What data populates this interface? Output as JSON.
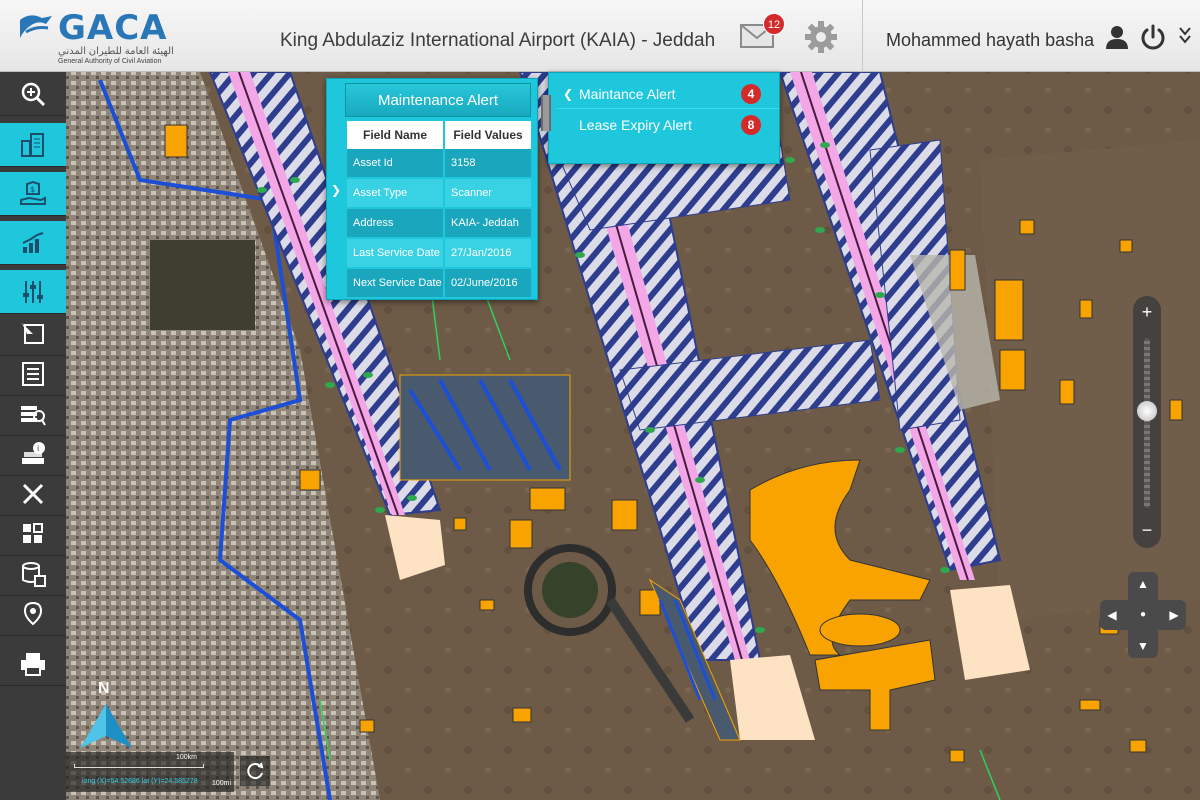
{
  "header": {
    "logo_text": "GACA",
    "logo_arabic": "الهيئة العامة للطيران المدني",
    "logo_english": "General Authority of Civil Aviation",
    "airport_title": "King Abdulaziz International Airport (KAIA) - Jeddah",
    "notification_count": "12",
    "user_name": "Mohammed  hayath basha",
    "icons": [
      "mail-icon",
      "gear-icon",
      "user-icon",
      "power-icon",
      "chevron-down-double-icon"
    ]
  },
  "sidebar": {
    "items": [
      {
        "name": "zoom-search",
        "icon": "magnifier-plus-icon",
        "active": false
      },
      {
        "name": "buildings",
        "icon": "buildings-icon",
        "active": true
      },
      {
        "name": "assets-finance",
        "icon": "money-hand-icon",
        "active": true
      },
      {
        "name": "analytics",
        "icon": "bar-chart-icon",
        "active": true
      },
      {
        "name": "settings-sliders",
        "icon": "sliders-icon",
        "active": true
      },
      {
        "name": "select-tool",
        "icon": "select-arrow-icon",
        "active": false
      },
      {
        "name": "report-list",
        "icon": "list-icon",
        "active": false
      },
      {
        "name": "layer-search",
        "icon": "layers-search-icon",
        "active": false
      },
      {
        "name": "asset-info",
        "icon": "stack-info-icon",
        "active": false
      },
      {
        "name": "measure-tool",
        "icon": "pencil-cross-icon",
        "active": false
      },
      {
        "name": "grid-view",
        "icon": "grid-icon",
        "active": false
      },
      {
        "name": "database-report",
        "icon": "database-icon",
        "active": false
      },
      {
        "name": "location-pin",
        "icon": "map-pin-icon",
        "active": false
      },
      {
        "name": "print",
        "icon": "printer-icon",
        "active": false
      }
    ]
  },
  "maintenance_popup": {
    "title": "Maintenance Alert",
    "col_field": "Field Name",
    "col_value": "Field Values",
    "rows": [
      {
        "field": "Asset Id",
        "value": "3158"
      },
      {
        "field": "Asset Type",
        "value": "Scanner"
      },
      {
        "field": "Address",
        "value": "KAIA- Jeddah"
      },
      {
        "field": "Last Service Date",
        "value": "27/Jan/2016"
      },
      {
        "field": "Next Service Date",
        "value": "02/June/2016"
      }
    ]
  },
  "alert_list": {
    "items": [
      {
        "label": "Maintance Alert",
        "count": "4"
      },
      {
        "label": "Lease Expiry Alert",
        "count": "8"
      }
    ]
  },
  "map_controls": {
    "zoom_in": "+",
    "zoom_out": "−",
    "zoom_level_fraction": 0.45,
    "north_label": "N",
    "scale_km": "100km",
    "scale_mi": "100mi",
    "coordinates": "long (X)=54.52686  lat (Y)=24.585278"
  },
  "colors": {
    "accent": "#1fc7dc",
    "sidebar": "#3b3b3b",
    "badge": "#d42a2a",
    "building_fill": "#f8a300",
    "runway_pink": "#f3a7e6"
  }
}
